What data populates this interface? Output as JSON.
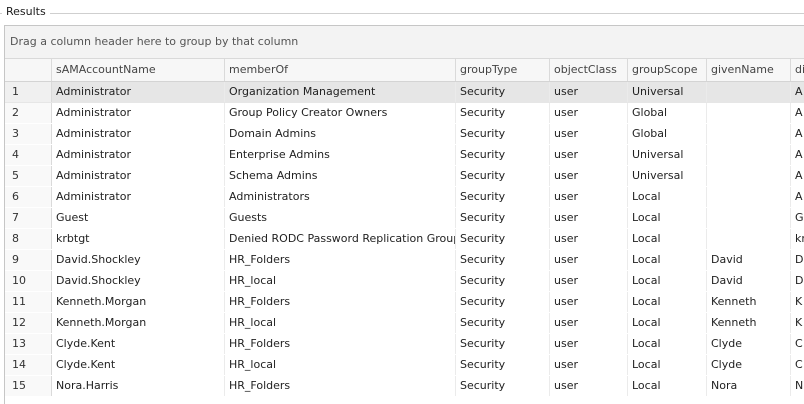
{
  "panel": {
    "title": "Results"
  },
  "grid": {
    "group_hint": "Drag a column header here to group by that column",
    "columns": [
      "",
      "sAMAccountName",
      "memberOf",
      "groupType",
      "objectClass",
      "groupScope",
      "givenName",
      "di"
    ],
    "rows": [
      {
        "n": "1",
        "sam": "Administrator",
        "memberOf": "Organization Management",
        "groupType": "Security",
        "objectClass": "user",
        "groupScope": "Universal",
        "givenName": "",
        "di": "A"
      },
      {
        "n": "2",
        "sam": "Administrator",
        "memberOf": "Group Policy Creator Owners",
        "groupType": "Security",
        "objectClass": "user",
        "groupScope": "Global",
        "givenName": "",
        "di": "A"
      },
      {
        "n": "3",
        "sam": "Administrator",
        "memberOf": "Domain Admins",
        "groupType": "Security",
        "objectClass": "user",
        "groupScope": "Global",
        "givenName": "",
        "di": "A"
      },
      {
        "n": "4",
        "sam": "Administrator",
        "memberOf": "Enterprise Admins",
        "groupType": "Security",
        "objectClass": "user",
        "groupScope": "Universal",
        "givenName": "",
        "di": "A"
      },
      {
        "n": "5",
        "sam": "Administrator",
        "memberOf": "Schema Admins",
        "groupType": "Security",
        "objectClass": "user",
        "groupScope": "Universal",
        "givenName": "",
        "di": "A"
      },
      {
        "n": "6",
        "sam": "Administrator",
        "memberOf": "Administrators",
        "groupType": "Security",
        "objectClass": "user",
        "groupScope": "Local",
        "givenName": "",
        "di": "A"
      },
      {
        "n": "7",
        "sam": "Guest",
        "memberOf": "Guests",
        "groupType": "Security",
        "objectClass": "user",
        "groupScope": "Local",
        "givenName": "",
        "di": "G"
      },
      {
        "n": "8",
        "sam": "krbtgt",
        "memberOf": "Denied RODC Password Replication Group",
        "groupType": "Security",
        "objectClass": "user",
        "groupScope": "Local",
        "givenName": "",
        "di": "kr"
      },
      {
        "n": "9",
        "sam": "David.Shockley",
        "memberOf": "HR_Folders",
        "groupType": "Security",
        "objectClass": "user",
        "groupScope": "Local",
        "givenName": "David",
        "di": "D"
      },
      {
        "n": "10",
        "sam": "David.Shockley",
        "memberOf": "HR_local",
        "groupType": "Security",
        "objectClass": "user",
        "groupScope": "Local",
        "givenName": "David",
        "di": "D"
      },
      {
        "n": "11",
        "sam": "Kenneth.Morgan",
        "memberOf": "HR_Folders",
        "groupType": "Security",
        "objectClass": "user",
        "groupScope": "Local",
        "givenName": "Kenneth",
        "di": "K"
      },
      {
        "n": "12",
        "sam": "Kenneth.Morgan",
        "memberOf": "HR_local",
        "groupType": "Security",
        "objectClass": "user",
        "groupScope": "Local",
        "givenName": "Kenneth",
        "di": "K"
      },
      {
        "n": "13",
        "sam": "Clyde.Kent",
        "memberOf": "HR_Folders",
        "groupType": "Security",
        "objectClass": "user",
        "groupScope": "Local",
        "givenName": "Clyde",
        "di": "C"
      },
      {
        "n": "14",
        "sam": "Clyde.Kent",
        "memberOf": "HR_local",
        "groupType": "Security",
        "objectClass": "user",
        "groupScope": "Local",
        "givenName": "Clyde",
        "di": "C"
      },
      {
        "n": "15",
        "sam": "Nora.Harris",
        "memberOf": "HR_Folders",
        "groupType": "Security",
        "objectClass": "user",
        "groupScope": "Local",
        "givenName": "Nora",
        "di": "N"
      }
    ]
  },
  "colors": {
    "selected_row": "#e6e6e6",
    "group_panel": "#f3f3f3"
  }
}
